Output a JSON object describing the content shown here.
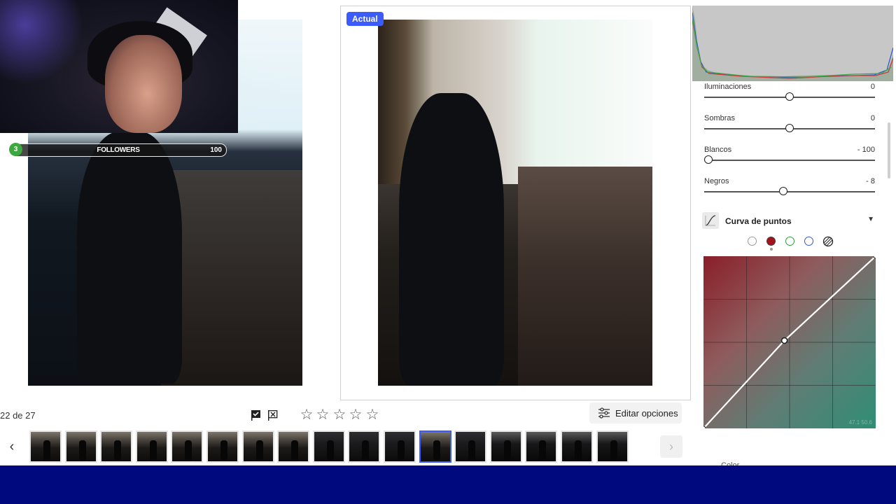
{
  "viewer": {
    "badge_label": "Actual",
    "counter_text": "22 de 27"
  },
  "stream_overlay": {
    "followers_current": "3",
    "followers_label": "FOLLOWERS",
    "followers_goal": "100"
  },
  "toolbar": {
    "flag_pick_icon": "flag-check-icon",
    "flag_reject_icon": "flag-x-icon",
    "rating_stars": 5,
    "rating_value": 0,
    "edit_options_label": "Editar opciones"
  },
  "filmstrip": {
    "prev_icon": "chevron-left-icon",
    "next_icon": "chevron-right-icon",
    "thumbnails": [
      {
        "index": 1,
        "tone": "warm",
        "selected": false
      },
      {
        "index": 2,
        "tone": "warm",
        "selected": false
      },
      {
        "index": 3,
        "tone": "warm",
        "selected": false
      },
      {
        "index": 4,
        "tone": "warm",
        "selected": false
      },
      {
        "index": 5,
        "tone": "warm",
        "selected": false
      },
      {
        "index": 6,
        "tone": "warm",
        "selected": false
      },
      {
        "index": 7,
        "tone": "warm",
        "selected": false
      },
      {
        "index": 8,
        "tone": "warm",
        "selected": false
      },
      {
        "index": 9,
        "tone": "dark",
        "selected": false
      },
      {
        "index": 10,
        "tone": "dark",
        "selected": false
      },
      {
        "index": 11,
        "tone": "dark",
        "selected": false
      },
      {
        "index": 12,
        "tone": "warm",
        "selected": true
      },
      {
        "index": 13,
        "tone": "dark",
        "selected": false
      },
      {
        "index": 14,
        "tone": "night",
        "selected": false
      },
      {
        "index": 15,
        "tone": "night",
        "selected": false
      },
      {
        "index": 16,
        "tone": "night",
        "selected": false
      },
      {
        "index": 17,
        "tone": "night",
        "selected": false
      }
    ]
  },
  "adjustments": {
    "sliders": [
      {
        "label": "Iluminaciones",
        "value": "0",
        "level": 0.5
      },
      {
        "label": "Sombras",
        "value": "0",
        "level": 0.5
      },
      {
        "label": "Blancos",
        "value": "- 100",
        "level": 0.0
      },
      {
        "label": "Negros",
        "value": "- 8",
        "level": 0.46
      }
    ]
  },
  "point_curve": {
    "title": "Curva de puntos",
    "active_channel": "red",
    "channels": [
      {
        "name": "rgb",
        "color": "#ffffff"
      },
      {
        "name": "red",
        "color": "#a0141e"
      },
      {
        "name": "green",
        "color": "#2e9e3a"
      },
      {
        "name": "blue",
        "color": "#3355d6"
      },
      {
        "name": "parametric",
        "color": "#222222"
      }
    ],
    "points": [
      [
        0,
        0
      ],
      [
        0.47,
        0.51
      ],
      [
        1,
        1
      ]
    ],
    "corner_readout": "47.1  50.6"
  },
  "colors": {
    "accent": "#3b5bfd",
    "bottom_bar": "#000a7e"
  },
  "next_section_label": "Color"
}
